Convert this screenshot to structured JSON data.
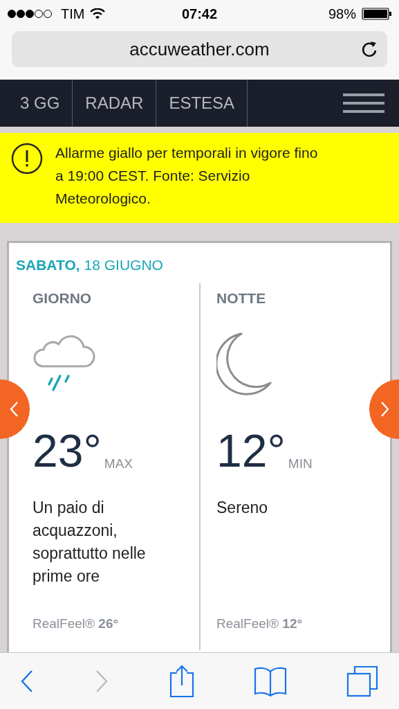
{
  "status_bar": {
    "carrier": "TIM",
    "time": "07:42",
    "battery": "98%"
  },
  "address_bar": {
    "url": "accuweather.com"
  },
  "nav": {
    "tabs": [
      {
        "label": "3 GG"
      },
      {
        "label": "RADAR"
      },
      {
        "label": "ESTESA"
      }
    ]
  },
  "alert": {
    "text": "Allarme giallo per temporali in vigore fino a 19:00 CEST. Fonte: Servizio Meteorologico."
  },
  "forecast": {
    "day": "SABATO,",
    "date": "18 GIUGNO",
    "periods": [
      {
        "label": "GIORNO",
        "kind": "rain",
        "temp": "23°",
        "qualifier": "MAX",
        "description": "Un paio di acquazzoni, soprattutto nelle prime ore",
        "realfeel": "RealFeel® **26°**"
      },
      {
        "label": "NOTTE",
        "kind": "moon",
        "temp": "12°",
        "qualifier": "MIN",
        "description": "Sereno",
        "realfeel": "RealFeel® **12°**"
      }
    ]
  },
  "toolbar": {
    "back_disabled": false,
    "forward_disabled": true
  }
}
